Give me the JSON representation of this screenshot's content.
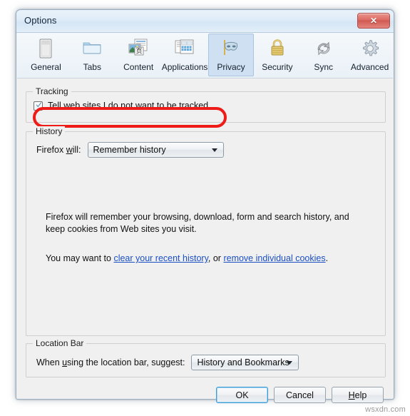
{
  "window": {
    "title": "Options",
    "close_label": "✕",
    "close_icon": "close-icon"
  },
  "toolbar": {
    "items": [
      {
        "label": "General",
        "icon": "general-icon",
        "selected": false
      },
      {
        "label": "Tabs",
        "icon": "tabs-icon",
        "selected": false
      },
      {
        "label": "Content",
        "icon": "content-icon",
        "selected": false
      },
      {
        "label": "Applications",
        "icon": "applications-icon",
        "selected": false
      },
      {
        "label": "Privacy",
        "icon": "privacy-mask-icon",
        "selected": true
      },
      {
        "label": "Security",
        "icon": "padlock-icon",
        "selected": false
      },
      {
        "label": "Sync",
        "icon": "sync-arrows-icon",
        "selected": false
      },
      {
        "label": "Advanced",
        "icon": "gear-icon",
        "selected": false
      }
    ]
  },
  "tracking": {
    "caption": "Tracking",
    "checkbox": {
      "checked": true,
      "text_before": "Tell web sites I ",
      "accesskey": "d",
      "text_after": "o not want to be tracked",
      "full_text": "Tell web sites I do not want to be tracked"
    },
    "highlight_color": "#ee1b16"
  },
  "history": {
    "caption": "History",
    "label_before": "Firefox ",
    "label_accesskey": "w",
    "label_after": "ill:",
    "label_full": "Firefox will:",
    "dropdown_value": "Remember history",
    "description_line1": "Firefox will remember your browsing, download, form and search history, and",
    "description_line2": "keep cookies from Web sites you visit.",
    "links_prefix": "You may want to ",
    "link1": "clear your recent history",
    "links_middle": ", or ",
    "link2": "remove individual cookies",
    "links_suffix": "."
  },
  "location_bar": {
    "caption": "Location Bar",
    "label_before": "When ",
    "label_accesskey": "u",
    "label_after": "sing the location bar, suggest:",
    "label_full": "When using the location bar, suggest:",
    "dropdown_value": "History and Bookmarks"
  },
  "buttons": {
    "ok": "OK",
    "cancel": "Cancel",
    "help_before": "",
    "help_accesskey": "H",
    "help_after": "elp",
    "help_full": "Help"
  },
  "watermark": "wsxdn.com"
}
